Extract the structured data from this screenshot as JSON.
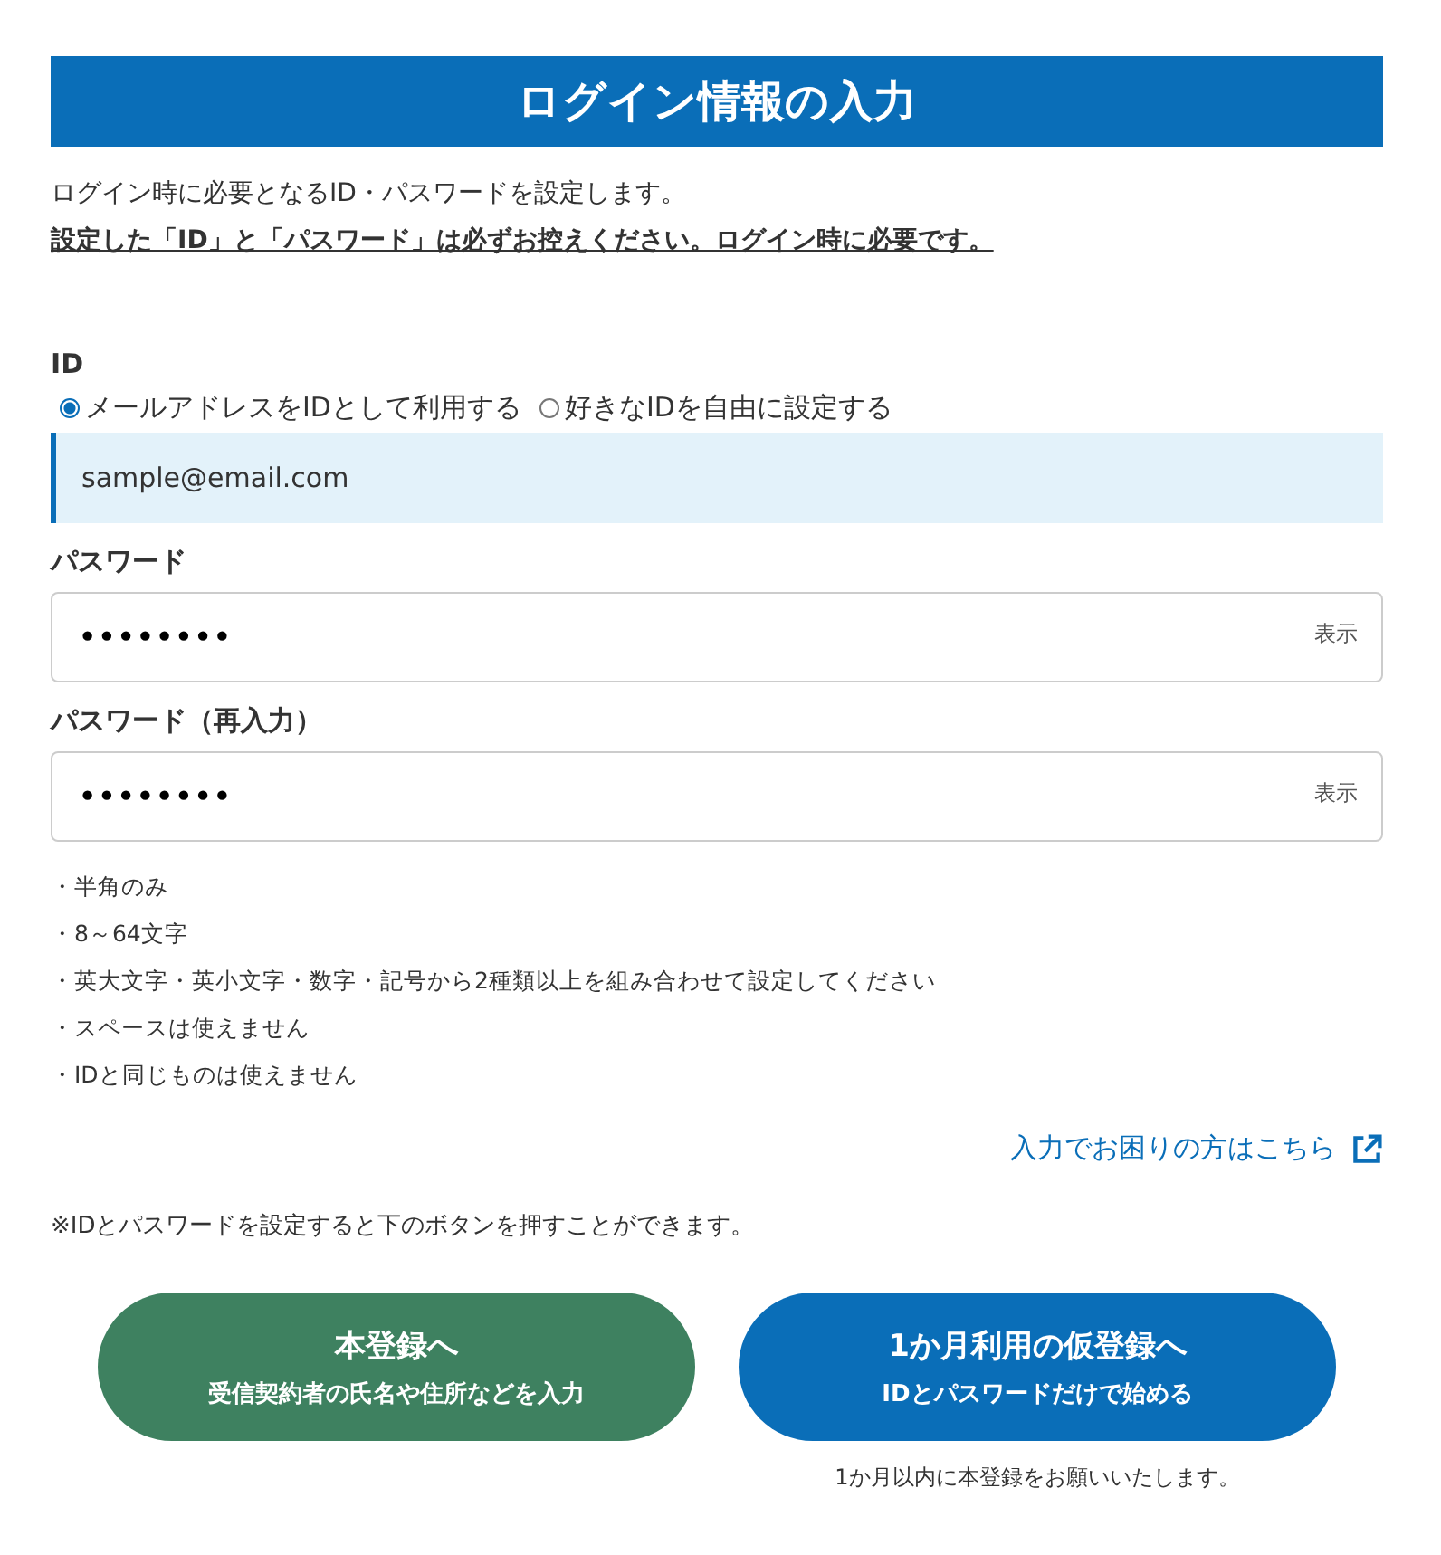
{
  "header": {
    "title": "ログイン情報の入力"
  },
  "intro": {
    "text": "ログイン時に必要となるID・パスワードを設定します。",
    "notice": "設定した「ID」と「パスワード」は必ずお控えください。ログイン時に必要です。"
  },
  "id_section": {
    "label": "ID",
    "options": [
      {
        "label": "メールアドレスをIDとして利用する",
        "selected": true
      },
      {
        "label": "好きなIDを自由に設定する",
        "selected": false
      }
    ],
    "value": "sample@email.com"
  },
  "password_fields": [
    {
      "label": "パスワード",
      "value": "••••••••",
      "toggle": "表示"
    },
    {
      "label": "パスワード（再入力）",
      "value": "••••••••",
      "toggle": "表示"
    }
  ],
  "rules": [
    "・半角のみ",
    "・8～64文字",
    "・英大文字・英小文字・数字・記号から2種類以上を組み合わせて設定してください",
    "・スペースは使えません",
    "・IDと同じものは使えません"
  ],
  "help_link": "入力でお困りの方はこちら",
  "note": "※IDとパスワードを設定すると下のボタンを押すことができます。",
  "actions": [
    {
      "kind": "full",
      "title": "本登録へ",
      "subtitle": "受信契約者の氏名や住所などを入力"
    },
    {
      "kind": "trial",
      "title": "1か月利用の仮登録へ",
      "subtitle": "IDとパスワードだけで始める",
      "caption": "1か月以内に本登録をお願いいたします。"
    }
  ]
}
